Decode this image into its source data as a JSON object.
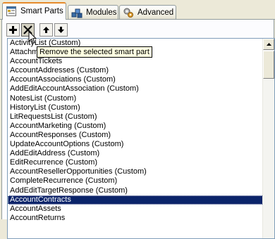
{
  "tabs": [
    {
      "label": "Smart Parts",
      "icon": "smart-parts-icon",
      "active": true
    },
    {
      "label": "Modules",
      "icon": "modules-icon",
      "active": false
    },
    {
      "label": "Advanced",
      "icon": "advanced-icon",
      "active": false
    }
  ],
  "toolbar": {
    "buttons": [
      {
        "name": "add-button",
        "icon": "plus-icon"
      },
      {
        "name": "remove-button",
        "icon": "x-icon"
      },
      {
        "name": "move-up-button",
        "icon": "arrow-up-icon"
      },
      {
        "name": "move-down-button",
        "icon": "arrow-down-icon"
      }
    ],
    "tooltip": "Remove the selected smart part"
  },
  "list": {
    "items": [
      "ActivityList (Custom)",
      "AttachmentList (Custom)",
      "AccountTickets",
      "AccountAddresses (Custom)",
      "AccountAssociations (Custom)",
      "AddEditAccountAssociation (Custom)",
      "NotesList (Custom)",
      "HistoryList (Custom)",
      "LitRequestsList (Custom)",
      "AccountMarketing (Custom)",
      "AccountResponses (Custom)",
      "UpdateAccountOptions (Custom)",
      "AddEditAddress (Custom)",
      "EditRecurrence (Custom)",
      "AccountResellerOpportunities (Custom)",
      "CompleteRecurrence (Custom)",
      "AddEditTargetResponse (Custom)",
      "AccountContracts",
      "AccountAssets",
      "AccountReturns"
    ],
    "selected_index": 17
  },
  "colors": {
    "selection": "#0a246a",
    "active_tab_accent": "#e68b2c",
    "tooltip_bg": "#ffffe1"
  }
}
